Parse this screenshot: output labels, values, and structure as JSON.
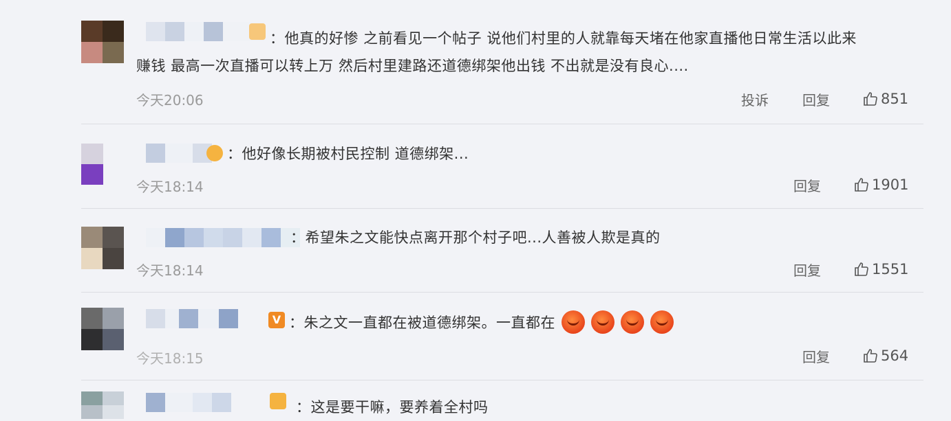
{
  "comments": [
    {
      "text_line1": "：他真的好惨 之前看见一个帖子 说他们村里的人就靠每天堵在他家直播他日常生活以此来",
      "text_line2": "赚钱 最高一次直播可以转上万 然后村里建路还道德绑架他出钱 不出就是没有良心....",
      "time": "今天20:06",
      "report_label": "投诉",
      "reply_label": "回复",
      "likes": "851"
    },
    {
      "text_line1": "：他好像长期被村民控制 道德绑架...",
      "time": "今天18:14",
      "reply_label": "回复",
      "likes": "1901"
    },
    {
      "text_line1": "：希望朱之文能快点离开那个村子吧...人善被人欺是真的",
      "time": "今天18:14",
      "reply_label": "回复",
      "likes": "1551"
    },
    {
      "text_line1": "：朱之文一直都在被道德绑架。一直都在",
      "time": "今天18:15",
      "reply_label": "回复",
      "likes": "564"
    },
    {
      "text_line1": "：这是要干嘛，要养着全村吗"
    }
  ],
  "icons": {
    "like": "thumbs-up-icon",
    "emoji": "angry-face-emoji"
  },
  "colors": {
    "background": "#f2f3f7",
    "text": "#333333",
    "meta": "#9a9a9a",
    "badge": "#f5b340",
    "emoji": "#e8451c"
  }
}
